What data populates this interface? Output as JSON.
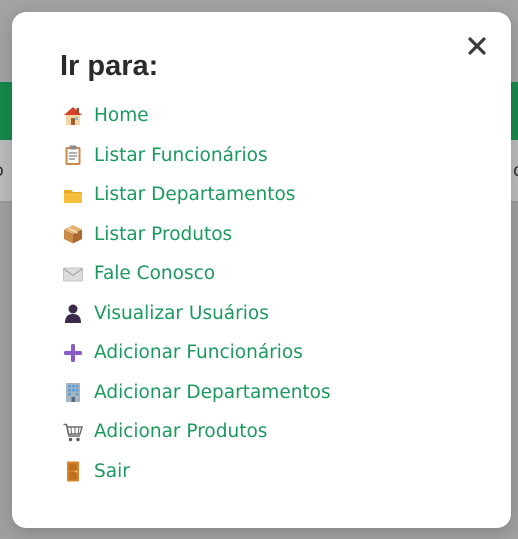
{
  "modal": {
    "title": "Ir para:",
    "close_label": "×"
  },
  "background": {
    "left_fragment": "ɔ",
    "right_fragment": "o"
  },
  "menu": {
    "items": [
      {
        "label": "Home",
        "icon": "house-icon"
      },
      {
        "label": "Listar Funcionários",
        "icon": "clipboard-icon"
      },
      {
        "label": "Listar Departamentos",
        "icon": "folder-icon"
      },
      {
        "label": "Listar Produtos",
        "icon": "package-icon"
      },
      {
        "label": "Fale Conosco",
        "icon": "envelope-icon"
      },
      {
        "label": "Visualizar Usuários",
        "icon": "user-silhouette-icon"
      },
      {
        "label": "Adicionar Funcionários",
        "icon": "plus-icon"
      },
      {
        "label": "Adicionar Departamentos",
        "icon": "office-building-icon"
      },
      {
        "label": "Adicionar Produtos",
        "icon": "shopping-cart-icon"
      },
      {
        "label": "Sair",
        "icon": "door-icon"
      }
    ]
  },
  "colors": {
    "link": "#1a9a5c",
    "header_green": "#178a4d",
    "overlay": "#a3a3a3",
    "title": "#2b2b2b"
  }
}
